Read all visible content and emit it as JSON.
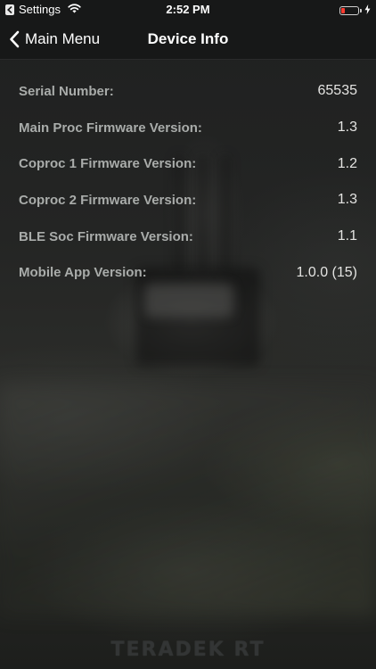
{
  "status_bar": {
    "back_app_label": "Settings",
    "time": "2:52 PM",
    "battery_level": 0.2,
    "battery_color": "#ff3b30",
    "icons": [
      "back-app-icon",
      "wifi-icon",
      "battery-icon",
      "charging-bolt-icon"
    ]
  },
  "nav": {
    "back_label": "Main Menu",
    "back_icon": "chevron-left-icon",
    "title": "Device Info"
  },
  "info_rows": [
    {
      "label": "Serial Number:",
      "value": "65535"
    },
    {
      "label": "Main Proc Firmware Version:",
      "value": "1.3"
    },
    {
      "label": "Coproc 1 Firmware Version:",
      "value": "1.2"
    },
    {
      "label": "Coproc 2 Firmware Version:",
      "value": "1.3"
    },
    {
      "label": "BLE Soc Firmware Version:",
      "value": "1.1"
    },
    {
      "label": "Mobile App Version:",
      "value": "1.0.0 (15)"
    }
  ],
  "watermark": "TERADEK RT",
  "colors": {
    "label": "#a9acaa",
    "value": "#e4e4e2",
    "bar_background": "#171818"
  }
}
